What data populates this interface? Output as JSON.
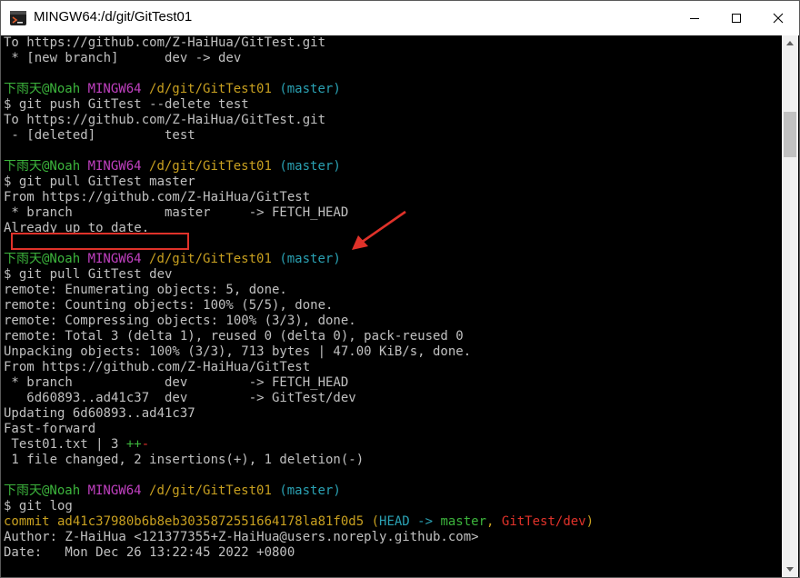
{
  "window": {
    "title": "MINGW64:/d/git/GitTest01",
    "minimize_label": "minimize",
    "maximize_label": "maximize",
    "close_label": "close"
  },
  "colors": {
    "default": "#c0c0c0",
    "green": "#3cb43c",
    "magenta": "#c040c0",
    "yellow": "#c8a020",
    "cyan": "#2aa1b3",
    "red": "#e0322a"
  },
  "terminal": {
    "lines": [
      [
        {
          "t": "To https://github.com/Z-HaiHua/GitTest.git",
          "c": "default"
        }
      ],
      [
        {
          "t": " * [new branch]      dev -> dev",
          "c": "default"
        }
      ],
      [
        {
          "t": "",
          "c": "default"
        }
      ],
      [
        {
          "t": "下雨天@Noah ",
          "c": "green"
        },
        {
          "t": "MINGW64 ",
          "c": "magenta"
        },
        {
          "t": "/d/git/GitTest01 ",
          "c": "yellow"
        },
        {
          "t": "(master)",
          "c": "cyan"
        }
      ],
      [
        {
          "t": "$ git push GitTest --delete test",
          "c": "default"
        }
      ],
      [
        {
          "t": "To https://github.com/Z-HaiHua/GitTest.git",
          "c": "default"
        }
      ],
      [
        {
          "t": " - [deleted]         test",
          "c": "default"
        }
      ],
      [
        {
          "t": "",
          "c": "default"
        }
      ],
      [
        {
          "t": "下雨天@Noah ",
          "c": "green"
        },
        {
          "t": "MINGW64 ",
          "c": "magenta"
        },
        {
          "t": "/d/git/GitTest01 ",
          "c": "yellow"
        },
        {
          "t": "(master)",
          "c": "cyan"
        }
      ],
      [
        {
          "t": "$ git pull GitTest master",
          "c": "default"
        }
      ],
      [
        {
          "t": "From https://github.com/Z-HaiHua/GitTest",
          "c": "default"
        }
      ],
      [
        {
          "t": " * branch            master     -> FETCH_HEAD",
          "c": "default"
        }
      ],
      [
        {
          "t": "Already up to date.",
          "c": "default"
        }
      ],
      [
        {
          "t": "",
          "c": "default"
        }
      ],
      [
        {
          "t": "下雨天@Noah ",
          "c": "green"
        },
        {
          "t": "MINGW64 ",
          "c": "magenta"
        },
        {
          "t": "/d/git/GitTest01 ",
          "c": "yellow"
        },
        {
          "t": "(master)",
          "c": "cyan"
        }
      ],
      [
        {
          "t": "$ git pull GitTest dev",
          "c": "default"
        }
      ],
      [
        {
          "t": "remote: Enumerating objects: 5, done.",
          "c": "default"
        }
      ],
      [
        {
          "t": "remote: Counting objects: 100% (5/5), done.",
          "c": "default"
        }
      ],
      [
        {
          "t": "remote: Compressing objects: 100% (3/3), done.",
          "c": "default"
        }
      ],
      [
        {
          "t": "remote: Total 3 (delta 1), reused 0 (delta 0), pack-reused 0",
          "c": "default"
        }
      ],
      [
        {
          "t": "Unpacking objects: 100% (3/3), 713 bytes | 47.00 KiB/s, done.",
          "c": "default"
        }
      ],
      [
        {
          "t": "From https://github.com/Z-HaiHua/GitTest",
          "c": "default"
        }
      ],
      [
        {
          "t": " * branch            dev        -> FETCH_HEAD",
          "c": "default"
        }
      ],
      [
        {
          "t": "   6d60893..ad41c37  dev        -> GitTest/dev",
          "c": "default"
        }
      ],
      [
        {
          "t": "Updating 6d60893..ad41c37",
          "c": "default"
        }
      ],
      [
        {
          "t": "Fast-forward",
          "c": "default"
        }
      ],
      [
        {
          "t": " Test01.txt | 3 ",
          "c": "default"
        },
        {
          "t": "++",
          "c": "green"
        },
        {
          "t": "-",
          "c": "red"
        }
      ],
      [
        {
          "t": " 1 file changed, 2 insertions(+), 1 deletion(-)",
          "c": "default"
        }
      ],
      [
        {
          "t": "",
          "c": "default"
        }
      ],
      [
        {
          "t": "下雨天@Noah ",
          "c": "green"
        },
        {
          "t": "MINGW64 ",
          "c": "magenta"
        },
        {
          "t": "/d/git/GitTest01 ",
          "c": "yellow"
        },
        {
          "t": "(master)",
          "c": "cyan"
        }
      ],
      [
        {
          "t": "$ git log",
          "c": "default"
        }
      ],
      [
        {
          "t": "commit ad41c37980b6b8eb3035872551664178la81f0d5 ",
          "c": "yellow"
        },
        {
          "t": "(",
          "c": "yellow"
        },
        {
          "t": "HEAD -> ",
          "c": "cyan"
        },
        {
          "t": "master",
          "c": "green"
        },
        {
          "t": ", ",
          "c": "yellow"
        },
        {
          "t": "GitTest/dev",
          "c": "red"
        },
        {
          "t": ")",
          "c": "yellow"
        }
      ],
      [
        {
          "t": "Author: Z-HaiHua <121377355+Z-HaiHua@users.noreply.github.com>",
          "c": "default"
        }
      ],
      [
        {
          "t": "Date:   Mon Dec 26 13:22:45 2022 +0800",
          "c": "default"
        }
      ]
    ]
  }
}
